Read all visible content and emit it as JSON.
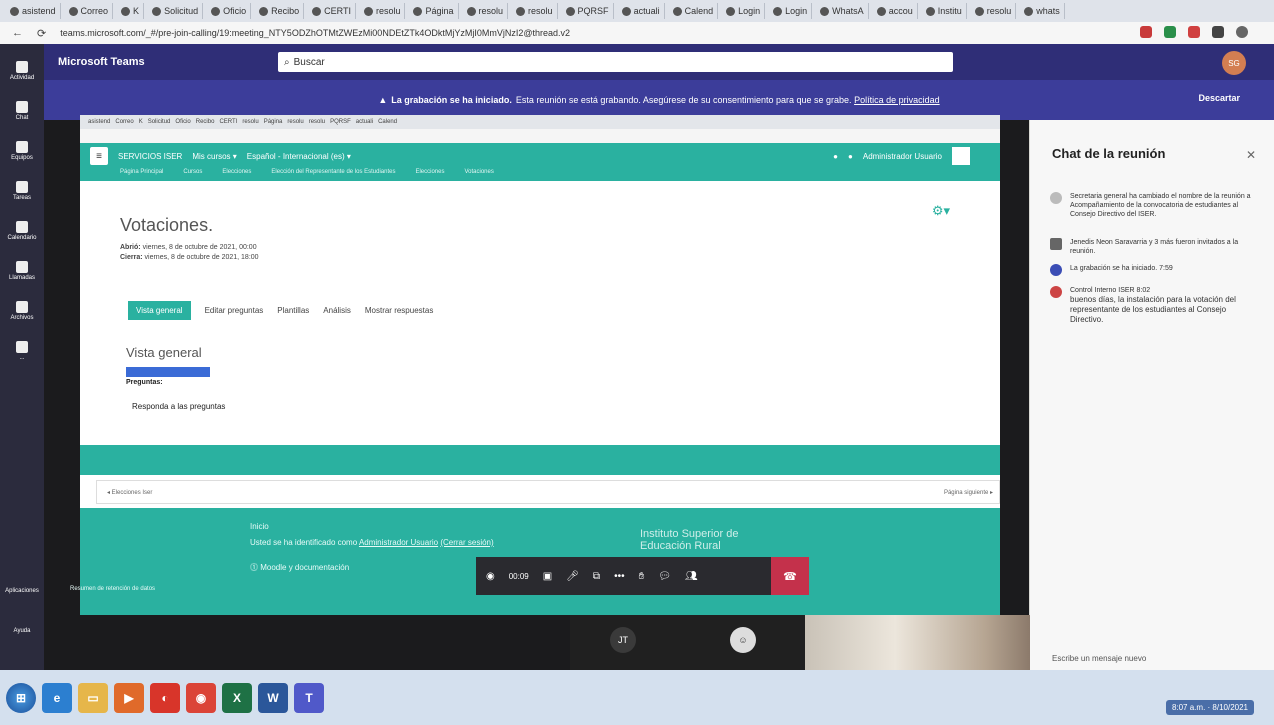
{
  "browser": {
    "tabs": [
      "asistend",
      "Correo",
      "K",
      "Solicitud",
      "Oficio",
      "Recibo",
      "CERTI",
      "resolu",
      "Página",
      "resolu",
      "resolu",
      "PQRSF",
      "actuali",
      "Calend",
      "Login",
      "Login",
      "WhatsA",
      "accou",
      "Institu",
      "resolu",
      "whats"
    ],
    "url": "teams.microsoft.com/_#/pre-join-calling/19:meeting_NTY5ODZhOTMtZWEzMi00NDEtZTk4ODktMjYzMjI0MmVjNzI2@thread.v2"
  },
  "teams": {
    "brand": "Microsoft Teams",
    "search_placeholder": "Buscar",
    "avatar": "SG",
    "rail": [
      "Actividad",
      "Chat",
      "Equipos",
      "Tareas",
      "Calendario",
      "Llamadas",
      "Archivos",
      "..."
    ],
    "rail_bottom": [
      "Aplicaciones",
      "Ayuda"
    ],
    "banner_bold": "La grabación se ha iniciado.",
    "banner_text": "Esta reunión se está grabando. Asegúrese de su consentimiento para que se grabe.",
    "banner_link": "Política de privacidad",
    "dismiss": "Descartar"
  },
  "shared": {
    "site": "SERVICIOS ISER",
    "menu": "Mis cursos ▾",
    "lang": "Español - Internacional (es) ▾",
    "user": "Administrador Usuario",
    "crumbs": [
      "Página Principal",
      "Cursos",
      "Elecciones",
      "Elección del Representante de los Estudiantes",
      "Elecciones",
      "Votaciones"
    ],
    "page_title": "Votaciones.",
    "opened_label": "Abrió:",
    "opened": "viernes, 8 de octubre de 2021, 00:00",
    "closes_label": "Cierra:",
    "closes": "viernes, 8 de octubre de 2021, 18:00",
    "subtabs": [
      "Vista general",
      "Editar preguntas",
      "Plantillas",
      "Análisis",
      "Mostrar respuestas"
    ],
    "section": "Vista general",
    "questions_label": "Preguntas:",
    "respond": "Responda a las preguntas",
    "footer_nav": "◂ Elecciones Iser",
    "footer_right": "Página siguiente ▸",
    "footer_block1": "Usted se ha identificado como",
    "footer_user": "Administrador Usuario",
    "footer_logout": "(Cerrar sesión)",
    "footer_home": "Inicio",
    "footer_moodle": "Moodle y documentación",
    "footer_inst": "Instituto Superior de Educación Rural",
    "bottom_link": "Resumen de retención de datos"
  },
  "call": {
    "timer": "00:09",
    "participants": [
      "JT",
      "avatar"
    ]
  },
  "chat": {
    "title": "Chat de la reunión",
    "messages": [
      "Secretaria general ha cambiado el nombre de la reunión a Acompañamiento de la convocatoria de estudiantes al Consejo Directivo del ISER.",
      "Jenedis Neon Saravarria y 3 más fueron invitados a la reunión.",
      "La grabación se ha iniciado.   7:59",
      "Control Interno ISER   8:02",
      "buenos días, la instalación para la votación del representante de los estudiantes al Consejo Directivo."
    ],
    "composer_placeholder": "Escribe un mensaje nuevo"
  },
  "taskbar": {
    "clock": "8:07 a.m.",
    "date": "8/10/2021"
  },
  "colors": {
    "teams_header": "#2f2e77",
    "banner": "#3c3d9a",
    "moodle_accent": "#2ab1a0",
    "hangup": "#c4314b"
  }
}
